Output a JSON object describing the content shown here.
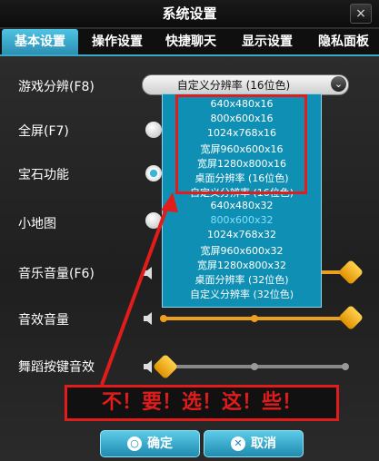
{
  "window": {
    "title": "系统设置",
    "close_label": "×"
  },
  "tabs": [
    {
      "label": "基本设置",
      "active": true
    },
    {
      "label": "操作设置",
      "active": false
    },
    {
      "label": "快捷聊天",
      "active": false
    },
    {
      "label": "显示设置",
      "active": false
    },
    {
      "label": "隐私面板",
      "active": false
    }
  ],
  "settings": {
    "resolution_label": "游戏分辨(F8)",
    "resolution_value": "自定义分辨率 (16位色)",
    "fullscreen_label": "全屏(F7)",
    "gem_label": "宝石功能",
    "minimap_label": "小地图",
    "music_label": "音乐音量(F6)",
    "sfx_label": "音效音量",
    "dance_sfx_label": "舞蹈按键音效"
  },
  "dropdown_options": [
    "640x480x16",
    "800x600x16",
    "1024x768x16",
    "宽屏960x600x16",
    "宽屏1280x800x16",
    "桌面分辨率 (16位色)",
    "自定义分辨率 (16位色)",
    "640x480x32",
    "800x600x32",
    "1024x768x32",
    "宽屏960x600x32",
    "宽屏1280x800x32",
    "桌面分辨率 (32位色)",
    "自定义分辨率 (32位色)"
  ],
  "annotation": "不！要！选！这！些！",
  "buttons": {
    "ok": "确定",
    "cancel": "取消"
  },
  "colors": {
    "accent": "#2a8fb3",
    "annotation": "#e21b1b",
    "slider_fill": "#e8a020"
  }
}
